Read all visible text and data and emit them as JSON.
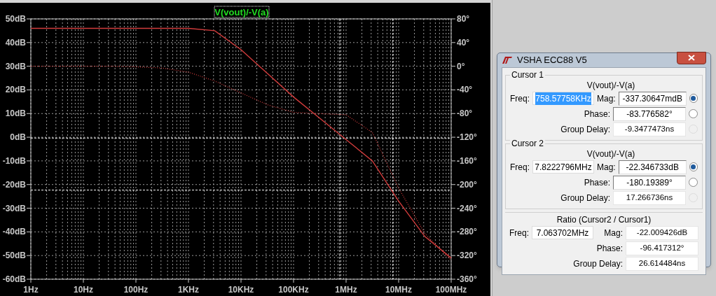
{
  "plot": {
    "chart_data": {
      "type": "line",
      "title": "V(vout)/-V(a)",
      "categories": [
        "1Hz",
        null,
        "10Hz",
        null,
        "100Hz",
        null,
        "1KHz",
        null,
        "10KHz",
        null,
        "100KHz",
        null,
        "1MHz",
        null,
        "10MHz",
        null,
        "100MHz"
      ],
      "ylim": [
        -60,
        50
      ],
      "yticks": [
        {
          "value": 50,
          "label": "50dB"
        },
        {
          "value": 40,
          "label": "40dB"
        },
        {
          "value": 30,
          "label": "30dB"
        },
        {
          "value": 20,
          "label": "20dB"
        },
        {
          "value": 10,
          "label": "10dB"
        },
        {
          "value": 0,
          "label": "0dB"
        },
        {
          "value": -10,
          "label": "-10dB"
        },
        {
          "value": -20,
          "label": "-20dB"
        },
        {
          "value": -30,
          "label": "-30dB"
        },
        {
          "value": -40,
          "label": "-40dB"
        },
        {
          "value": -50,
          "label": "-50dB"
        },
        {
          "value": -60,
          "label": "-60dB"
        }
      ],
      "y2lim": [
        -360,
        80
      ],
      "y2ticks": [
        {
          "value": 80,
          "label": "80°"
        },
        {
          "value": 40,
          "label": "40°"
        },
        {
          "value": 0,
          "label": "0°"
        },
        {
          "value": -40,
          "label": "-40°"
        },
        {
          "value": -80,
          "label": "-80°"
        },
        {
          "value": -120,
          "label": "-120°"
        },
        {
          "value": -160,
          "label": "-160°"
        },
        {
          "value": -200,
          "label": "-200°"
        },
        {
          "value": -240,
          "label": "-240°"
        },
        {
          "value": -280,
          "label": "-280°"
        },
        {
          "value": -320,
          "label": "-320°"
        },
        {
          "value": -360,
          "label": "-360°"
        }
      ],
      "series": [
        {
          "color": "#d23c3c",
          "line_style": "solid",
          "values": [
            46,
            46,
            46,
            46,
            46,
            46,
            46,
            45,
            37,
            27,
            17,
            8,
            -1,
            -10,
            -27,
            -42,
            -51
          ]
        },
        {
          "color": "#d23c3c",
          "axis": "y2",
          "line_style": "dotted",
          "values": [
            0,
            0,
            0,
            0,
            -1,
            -3,
            -10,
            -25,
            -45,
            -65,
            -78,
            -80,
            -82,
            -112,
            -206,
            -283,
            -328
          ]
        }
      ],
      "grid": true
    }
  },
  "dialog": {
    "title": "VSHA ECC88 V5",
    "sections": [
      {
        "kind": "cursor",
        "heading": "Cursor 1",
        "expression": "V(vout)/-V(a)",
        "freq_label": "Freq:",
        "freq": "758.57758KHz",
        "freq_selected": true,
        "rows": [
          {
            "label": "Mag:",
            "value": "-337.30647mdB",
            "kind": "field",
            "selected": true,
            "disabled": false
          },
          {
            "label": "Phase:",
            "value": "-83.776582°",
            "kind": "field",
            "selected": false,
            "disabled": false
          },
          {
            "label": "Group Delay:",
            "value": "-9.3477473ns",
            "kind": "readout",
            "selected": false,
            "disabled": true
          }
        ]
      },
      {
        "kind": "cursor",
        "heading": "Cursor 2",
        "expression": "V(vout)/-V(a)",
        "freq_label": "Freq:",
        "freq": "7.8222796MHz",
        "freq_selected": false,
        "rows": [
          {
            "label": "Mag:",
            "value": "-22.346733dB",
            "kind": "field",
            "selected": true,
            "disabled": false
          },
          {
            "label": "Phase:",
            "value": "-180.19389°",
            "kind": "field",
            "selected": false,
            "disabled": false
          },
          {
            "label": "Group Delay:",
            "value": "17.266736ns",
            "kind": "readout",
            "selected": false,
            "disabled": true
          }
        ]
      },
      {
        "kind": "ratio",
        "heading": "Ratio (Cursor2 / Cursor1)",
        "freq_label": "Freq:",
        "freq": "7.063702MHz",
        "freq_selected": false,
        "rows": [
          {
            "label": "Mag:",
            "value": "-22.009426dB",
            "kind": "readout"
          },
          {
            "label": "Phase:",
            "value": "-96.417312°",
            "kind": "readout"
          },
          {
            "label": "Group Delay:",
            "value": "26.614484ns",
            "kind": "readout"
          }
        ]
      }
    ]
  }
}
